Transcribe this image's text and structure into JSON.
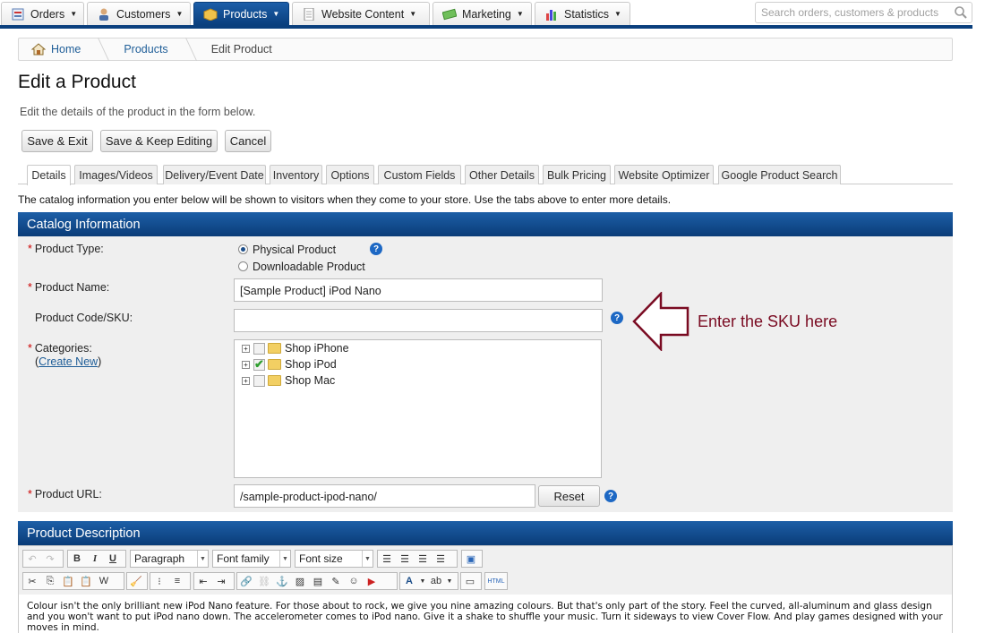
{
  "nav": {
    "tabs": [
      {
        "label": "Orders",
        "icon": "orders-icon"
      },
      {
        "label": "Customers",
        "icon": "customers-icon"
      },
      {
        "label": "Products",
        "icon": "products-icon",
        "active": true
      },
      {
        "label": "Website Content",
        "icon": "website-content-icon"
      },
      {
        "label": "Marketing",
        "icon": "marketing-icon"
      },
      {
        "label": "Statistics",
        "icon": "statistics-icon"
      }
    ],
    "search_placeholder": "Search orders, customers & products"
  },
  "breadcrumb": [
    "Home",
    "Products",
    "Edit Product"
  ],
  "page": {
    "title": "Edit a Product",
    "intro": "Edit the details of the product in the form below."
  },
  "actions": {
    "save_exit": "Save & Exit",
    "save_keep": "Save & Keep Editing",
    "cancel": "Cancel"
  },
  "tabs": [
    "Details",
    "Images/Videos",
    "Delivery/Event Date",
    "Inventory",
    "Options",
    "Custom Fields",
    "Other Details",
    "Bulk Pricing",
    "Website Optimizer",
    "Google Product Search"
  ],
  "catalog_note": "The catalog information you enter below will be shown to visitors when they come to your store. Use the tabs above to enter more details.",
  "catalog": {
    "header": "Catalog Information",
    "product_type_label": "Product Type:",
    "type_physical": "Physical Product",
    "type_downloadable": "Downloadable Product",
    "product_name_label": "Product Name:",
    "product_name_value": "[Sample Product] iPod Nano",
    "sku_label": "Product Code/SKU:",
    "sku_value": "",
    "categories_label": "Categories:",
    "create_new": "Create New",
    "categories": [
      {
        "label": "Shop iPhone",
        "checked": false
      },
      {
        "label": "Shop iPod",
        "checked": true
      },
      {
        "label": "Shop Mac",
        "checked": false
      }
    ],
    "url_label": "Product URL:",
    "url_value": "/sample-product-ipod-nano/",
    "reset": "Reset"
  },
  "callout": "Enter the SKU here",
  "description": {
    "header": "Product Description",
    "paragraph_select": "Paragraph",
    "font_family_select": "Font family",
    "font_size_select": "Font size",
    "bold": "B",
    "italic": "I",
    "underline": "U",
    "html_button": "HTML",
    "text": "Colour isn't the only brilliant new iPod Nano feature. For those about to rock, we give you nine amazing colours. But that's only part of the story. Feel the curved, all-aluminum and glass design and you won't want to put iPod nano down. The accelerometer comes to iPod nano. Give it a shake to shuffle your music. Turn it sideways to view Cover Flow. And play games designed with your moves in mind."
  }
}
